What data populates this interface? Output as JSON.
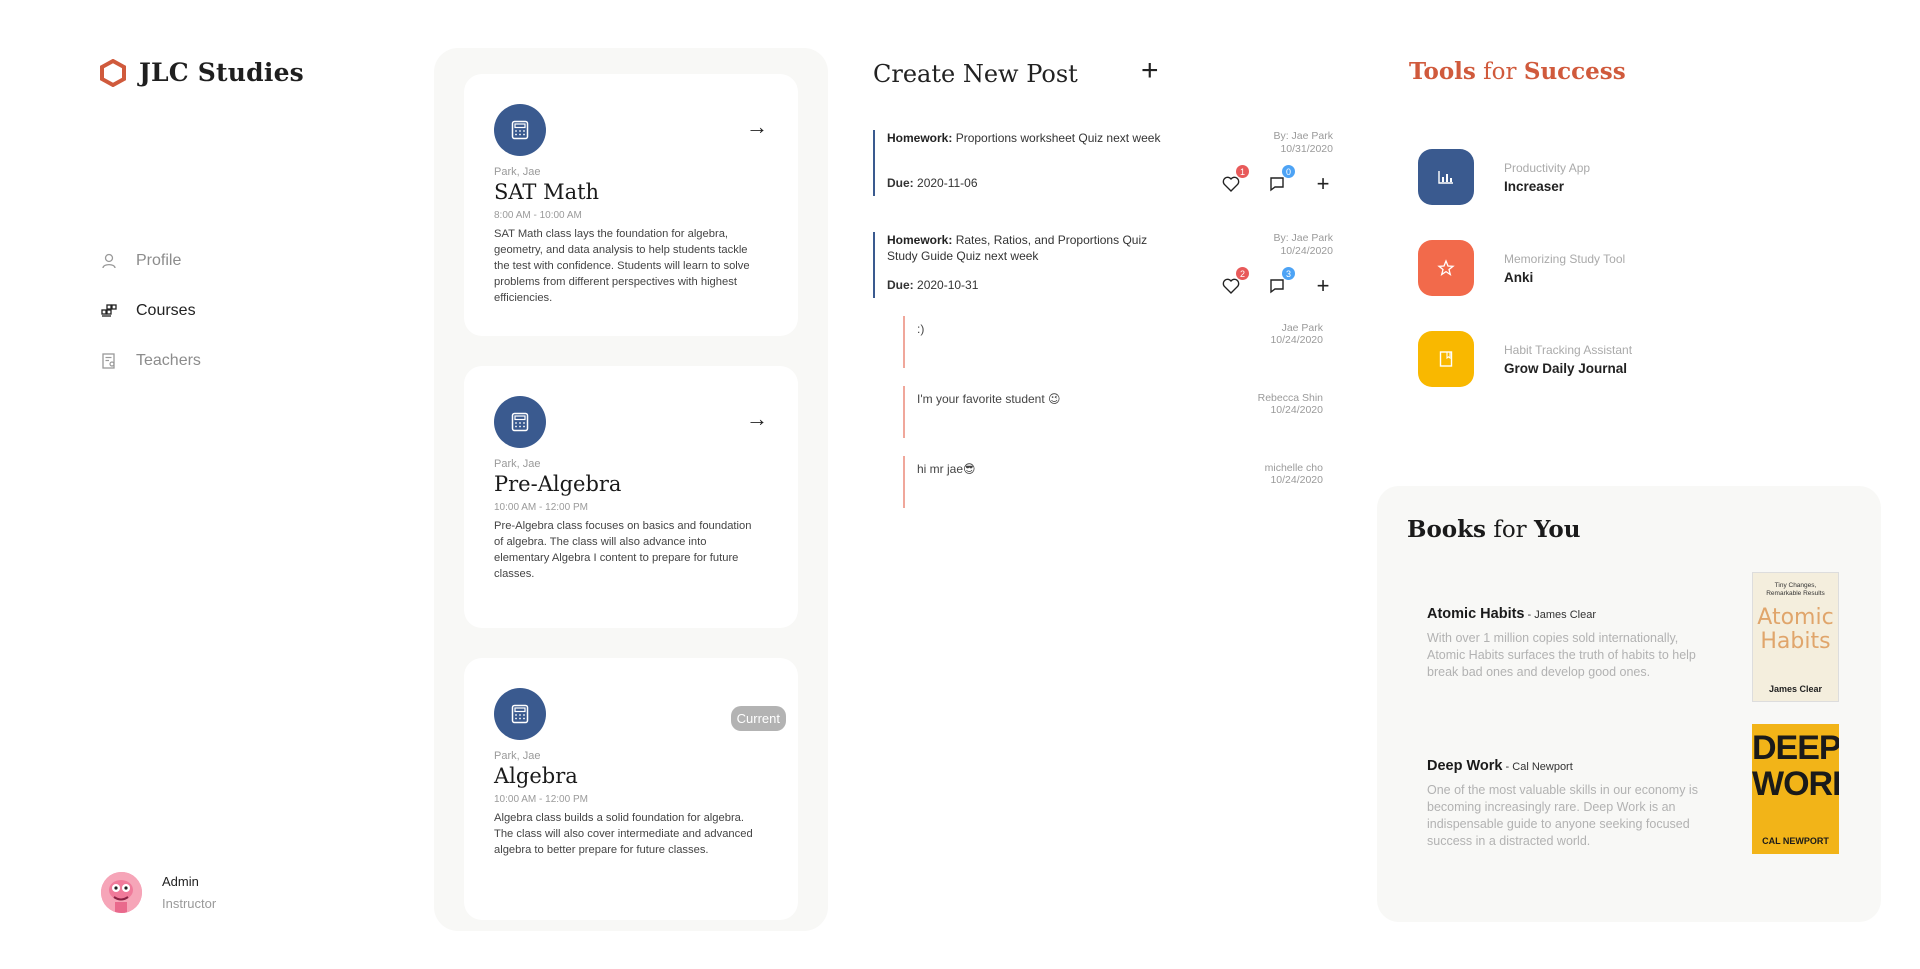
{
  "app": {
    "brand": "JLC Studies"
  },
  "sidebar": {
    "items": [
      {
        "label": "Profile",
        "icon": "user-icon"
      },
      {
        "label": "Courses",
        "icon": "courses-icon",
        "active": true
      },
      {
        "label": "Teachers",
        "icon": "teachers-icon"
      }
    ],
    "user": {
      "name": "Admin",
      "role": "Instructor"
    }
  },
  "courses": [
    {
      "teacher": "Park, Jae",
      "title": "SAT Math",
      "time": "8:00 AM - 10:00 AM",
      "description": "SAT Math class lays the foundation for algebra, geometry, and data analysis to help students tackle the test with confidence. Students will learn to solve problems from different perspectives with highest efficiencies.",
      "action": "arrow-right-icon"
    },
    {
      "teacher": "Park, Jae",
      "title": "Pre-Algebra",
      "time": "10:00 AM - 12:00 PM",
      "description": "Pre-Algebra class focuses on basics and foundation of algebra. The class will also advance into elementary Algebra I content to prepare for future classes.",
      "action": "arrow-right-icon"
    },
    {
      "teacher": "Park, Jae",
      "title": "Algebra",
      "time": "10:00 AM - 12:00 PM",
      "description": "Algebra class builds a solid foundation for algebra. The class will also cover intermediate and advanced algebra to better prepare for future classes.",
      "badge": "Current"
    }
  ],
  "posts": {
    "header": "Create New Post",
    "items": [
      {
        "kind": "Homework:",
        "text": "Proportions worksheet Quiz next week",
        "due_label": "Due:",
        "due": "2020-11-06",
        "by": "By: Jae Park",
        "date": "10/31/2020",
        "likes": "1",
        "comments": "0"
      },
      {
        "kind": "Homework:",
        "text": "Rates, Ratios, and Proportions Quiz Study Guide Quiz next week",
        "due_label": "Due:",
        "due": "2020-10-31",
        "by": "By: Jae Park",
        "date": "10/24/2020",
        "likes": "2",
        "comments": "3"
      }
    ],
    "comments": [
      {
        "text": ":)",
        "author": "Jae Park",
        "date": "10/24/2020"
      },
      {
        "text": "I'm your favorite student 😉",
        "author": "Rebecca Shin",
        "date": "10/24/2020"
      },
      {
        "text": "hi mr jae😎",
        "author": "michelle cho",
        "date": "10/24/2020"
      }
    ]
  },
  "tools": {
    "title_a": "Tools",
    "title_b": " for ",
    "title_c": "Success",
    "items": [
      {
        "category": "Productivity App",
        "name": "Increaser",
        "color": "#3a5a8f",
        "icon": "bar-chart-icon"
      },
      {
        "category": "Memorizing Study Tool",
        "name": "Anki",
        "color": "#f26a4b",
        "icon": "star-icon"
      },
      {
        "category": "Habit Tracking Assistant",
        "name": "Grow Daily Journal",
        "color": "#f9b800",
        "icon": "journal-icon"
      }
    ]
  },
  "books": {
    "title_a": "Books",
    "title_b": " for ",
    "title_c": "You",
    "items": [
      {
        "title": "Atomic Habits",
        "author": " - James Clear",
        "description": "With over 1 million copies sold internationally, Atomic Habits surfaces the truth of habits to help break bad ones and develop good ones.",
        "cover_top": "Tiny Changes, Remarkable Results",
        "cover_title_1": "Atomic",
        "cover_title_2": "Habits",
        "cover_author": "James Clear"
      },
      {
        "title": "Deep Work",
        "author": " - Cal Newport",
        "description": "One of the most valuable skills in our economy is becoming increasingly rare. Deep Work is an indispensable guide to anyone seeking focused success in a distracted world.",
        "cover_title_1": "DEEP",
        "cover_title_2": "WORK",
        "cover_author": "CAL NEWPORT"
      }
    ]
  }
}
